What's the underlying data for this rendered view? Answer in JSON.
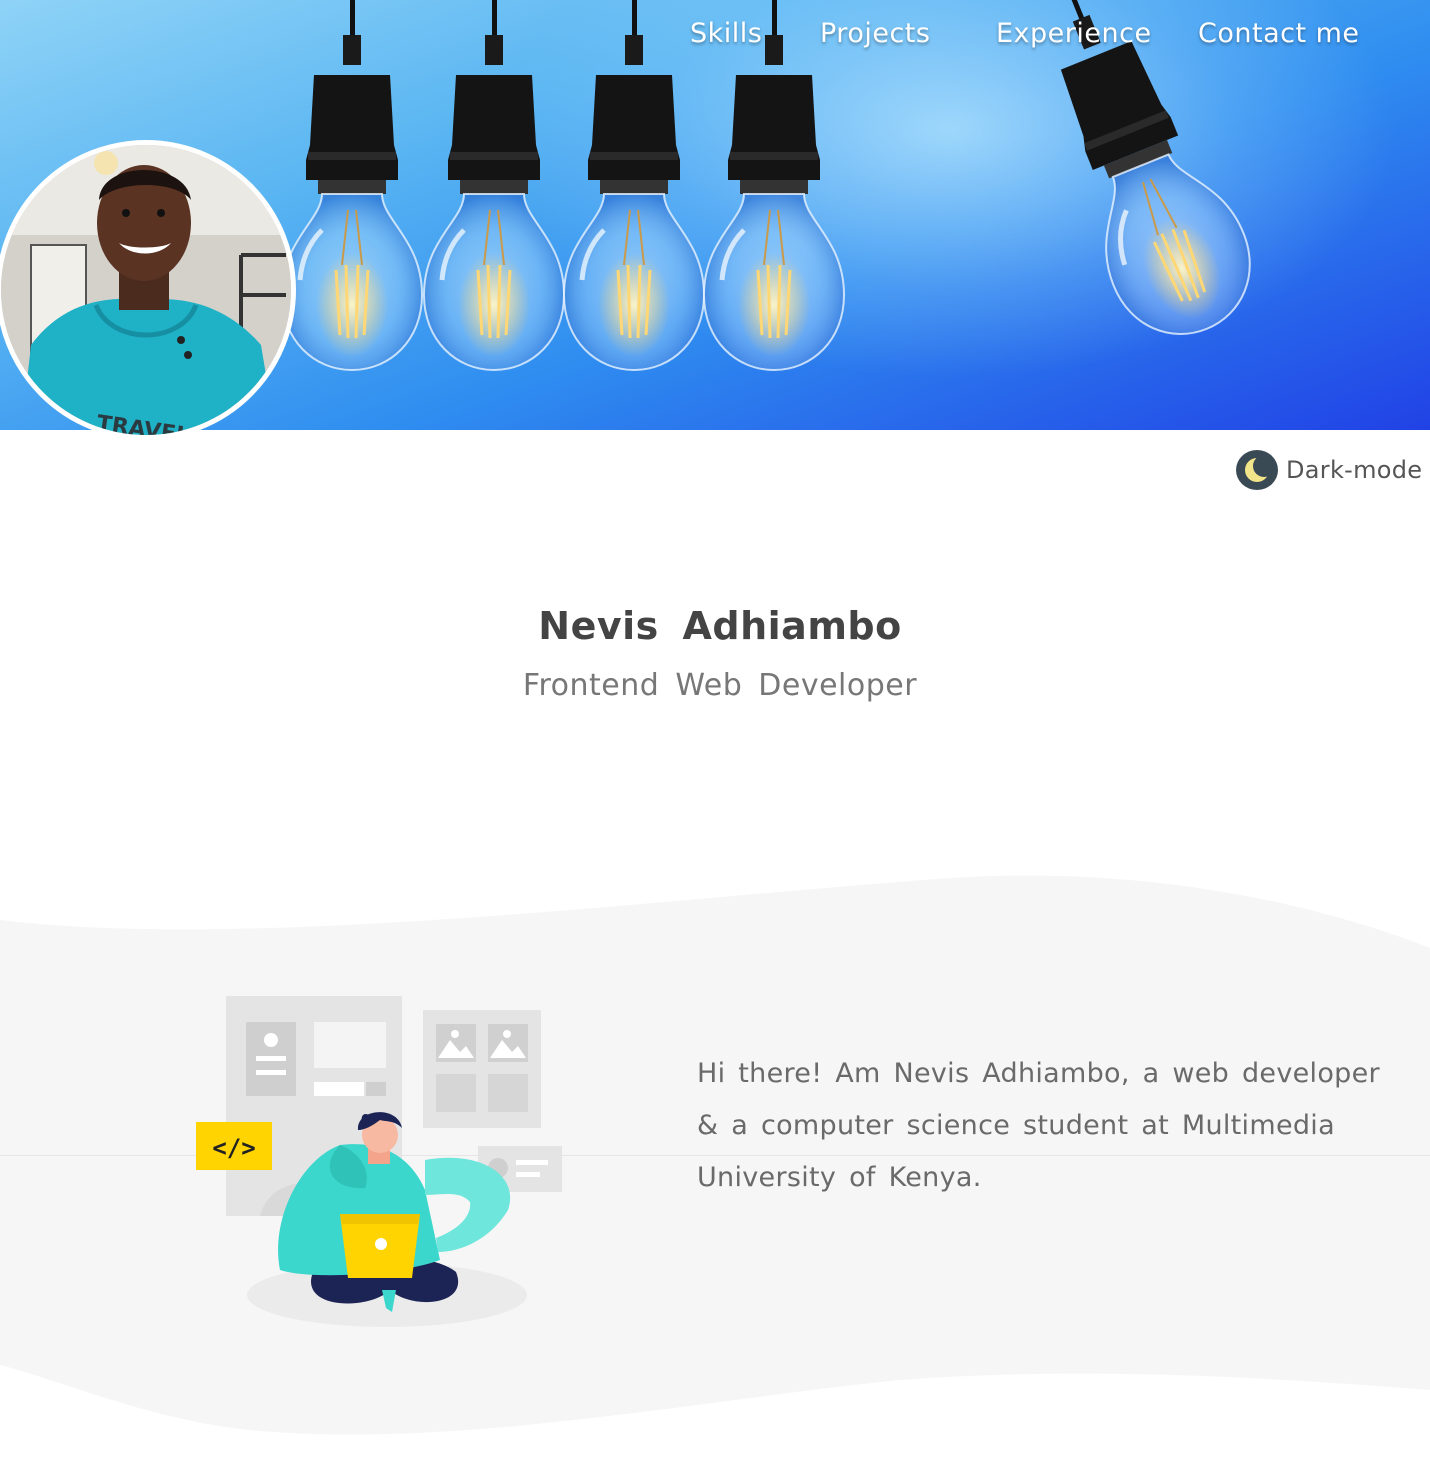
{
  "nav": {
    "skills": "Skills",
    "projects": "Projects",
    "experience": "Experience",
    "contact": "Contact me"
  },
  "dark_mode": {
    "label": "Dark-mode",
    "icon": "moon-icon"
  },
  "profile": {
    "name": "Nevis Adhiambo",
    "role": "Frontend Web Developer"
  },
  "about": {
    "bio": "Hi there! Am Nevis Adhiambo, a web developer & a computer science student at Multimedia University of Kenya."
  },
  "colors": {
    "banner_start": "#8fd3f7",
    "banner_end": "#2142e6",
    "illustration_teal": "#3ad9cf",
    "illustration_yellow": "#ffd400",
    "section_bg": "#f6f6f6"
  }
}
